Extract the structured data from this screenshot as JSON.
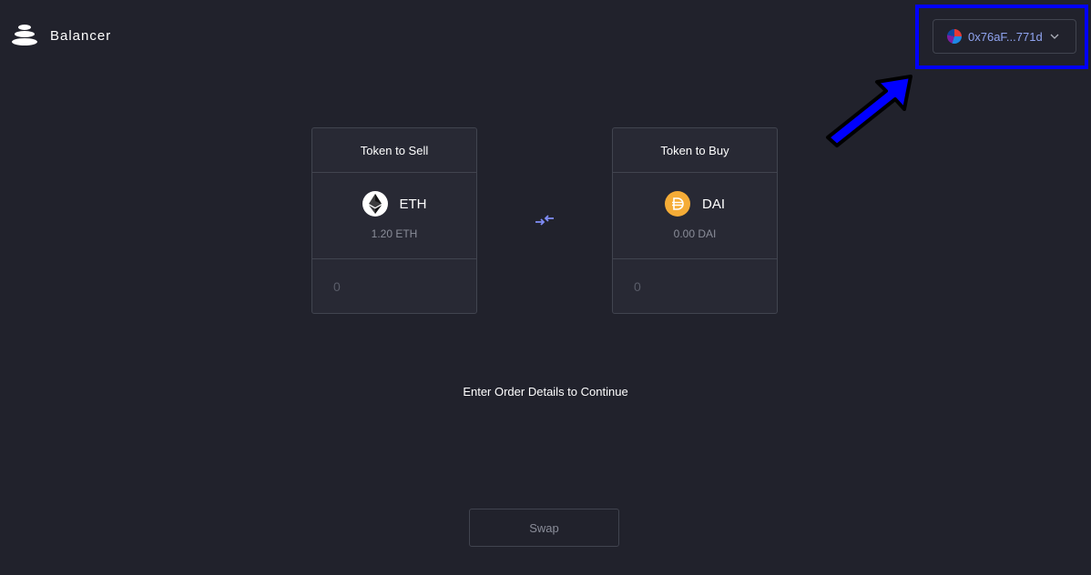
{
  "header": {
    "brand_name": "Balancer",
    "wallet": {
      "address": "0x76aF...771d"
    }
  },
  "sell_card": {
    "title": "Token to Sell",
    "token_symbol": "ETH",
    "token_icon": "ethereum-icon",
    "balance": "1.20 ETH",
    "amount_placeholder": "0"
  },
  "buy_card": {
    "title": "Token to Buy",
    "token_symbol": "DAI",
    "token_icon": "dai-icon",
    "balance": "0.00 DAI",
    "amount_placeholder": "0"
  },
  "swap_direction_icon": "swap-arrows-icon",
  "message": "Enter Order Details to Continue",
  "swap_button": {
    "label": "Swap"
  },
  "colors": {
    "background": "#21222c",
    "card": "#282934",
    "border": "#41444f",
    "accent": "#90a4f0",
    "annotation": "#0000ff",
    "dai": "#f5ac37"
  }
}
